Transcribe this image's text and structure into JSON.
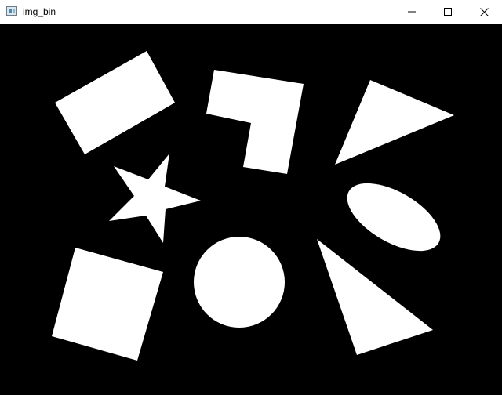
{
  "window": {
    "title": "img_bin",
    "controls": {
      "minimize_icon": "minimize-icon",
      "maximize_icon": "maximize-icon",
      "close_icon": "close-icon"
    }
  },
  "image": {
    "background_color": "#000000",
    "foreground_color": "#ffffff",
    "shapes": [
      {
        "name": "rotated-rectangle",
        "type": "polygon"
      },
      {
        "name": "l-shape",
        "type": "polygon"
      },
      {
        "name": "triangle-top-right",
        "type": "polygon"
      },
      {
        "name": "star",
        "type": "polygon"
      },
      {
        "name": "ellipse",
        "type": "ellipse"
      },
      {
        "name": "rotated-square",
        "type": "polygon"
      },
      {
        "name": "circle",
        "type": "circle"
      },
      {
        "name": "triangle-bottom-right",
        "type": "polygon"
      }
    ]
  }
}
